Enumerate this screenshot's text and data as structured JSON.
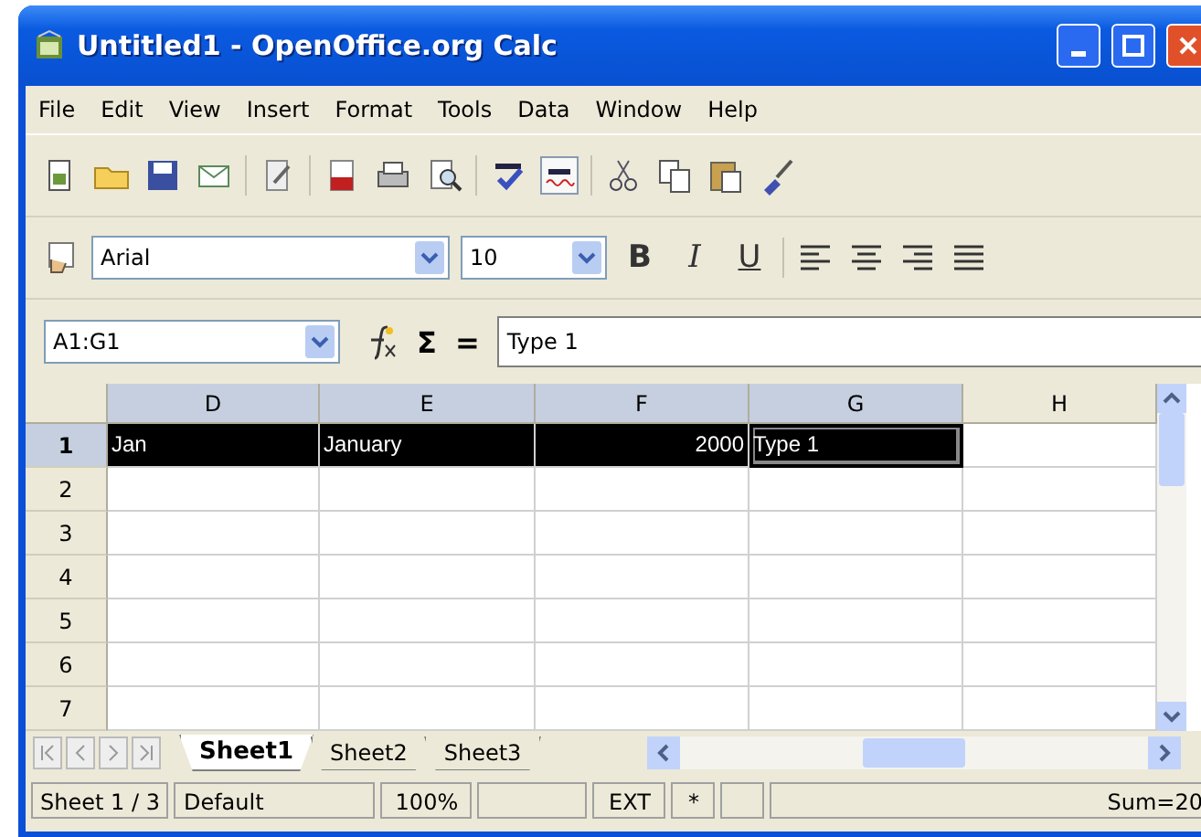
{
  "window": {
    "title": "Untitled1 - OpenOffice.org Calc"
  },
  "menu": [
    {
      "label": "File"
    },
    {
      "label": "Edit"
    },
    {
      "label": "View"
    },
    {
      "label": "Insert"
    },
    {
      "label": "Format"
    },
    {
      "label": "Tools"
    },
    {
      "label": "Data"
    },
    {
      "label": "Window"
    },
    {
      "label": "Help"
    }
  ],
  "formatting": {
    "font": "Arial",
    "size": "10",
    "bold": "B",
    "italic": "I",
    "underline": "U"
  },
  "formula_bar": {
    "name_box": "A1:G1",
    "sum": "Σ",
    "equals": "=",
    "value": "Type 1"
  },
  "columns": [
    {
      "label": "D",
      "selected": true
    },
    {
      "label": "E",
      "selected": true
    },
    {
      "label": "F",
      "selected": true
    },
    {
      "label": "G",
      "selected": true
    },
    {
      "label": "H",
      "selected": false
    }
  ],
  "rows": [
    {
      "label": "1",
      "selected": true,
      "cells": [
        {
          "text": "Jan",
          "kind": "text",
          "selected": true,
          "cursor": false
        },
        {
          "text": "January",
          "kind": "text",
          "selected": true,
          "cursor": false
        },
        {
          "text": "2000",
          "kind": "number",
          "selected": true,
          "cursor": false
        },
        {
          "text": "Type 1",
          "kind": "text",
          "selected": true,
          "cursor": true
        }
      ]
    },
    {
      "label": "2",
      "selected": false
    },
    {
      "label": "3",
      "selected": false
    },
    {
      "label": "4",
      "selected": false
    },
    {
      "label": "5",
      "selected": false
    },
    {
      "label": "6",
      "selected": false
    },
    {
      "label": "7",
      "selected": false
    }
  ],
  "sheet_tabs": [
    {
      "label": "Sheet1",
      "selected": true
    },
    {
      "label": "Sheet2",
      "selected": false
    },
    {
      "label": "Sheet3",
      "selected": false
    }
  ],
  "status_bar": {
    "sheet": "Sheet 1 / 3",
    "style": "Default",
    "zoom": "100%",
    "selection_mode": "EXT",
    "modified": "*",
    "sum": "Sum=20"
  }
}
